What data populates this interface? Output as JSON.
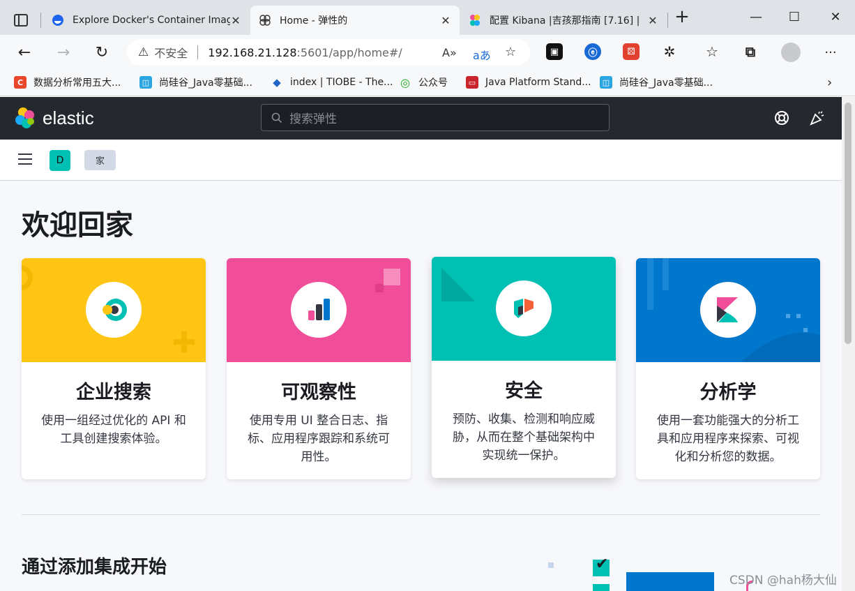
{
  "tabs": [
    {
      "title": "Explore Docker's Container Imag",
      "close": "✕"
    },
    {
      "title": "Home - 弹性的",
      "close": "✕"
    },
    {
      "title": "配置 Kibana |吉孩那指南 [7.16] |",
      "close": "✕"
    }
  ],
  "new_tab": "+",
  "window": {
    "minimize": "—",
    "maximize": "☐",
    "close": "✕"
  },
  "address_bar": {
    "security_label": "不安全",
    "host": "192.168.21.128",
    "path": ":5601/app/home#/"
  },
  "bookmarks": [
    {
      "label": "数据分析常用五大...",
      "icon": "C",
      "color": "#e8472b"
    },
    {
      "label": "尚硅谷_Java零基础...",
      "icon": "◫",
      "color": "#2ca6e0"
    },
    {
      "label": "index | TIOBE - The...",
      "icon": "◆",
      "color": "#1f63c6"
    },
    {
      "label": "公众号",
      "icon": "◎",
      "color": "#1aad19"
    },
    {
      "label": "Java Platform Stand...",
      "icon": "▭",
      "color": "#c9252c"
    },
    {
      "label": "尚硅谷_Java零基础...",
      "icon": "◫",
      "color": "#2ca6e0"
    }
  ],
  "kibana": {
    "brand": "elastic",
    "search_placeholder": "搜索弹性",
    "space_initial": "D",
    "breadcrumb": "家"
  },
  "page": {
    "title": "欢迎回家",
    "cards": [
      {
        "title": "企业搜索",
        "description": "使用一组经过优化的 API 和工具创建搜索体验。",
        "color": "#fec514",
        "icon": "enterprise-search-icon"
      },
      {
        "title": "可观察性",
        "description": "使用专用 UI 整合日志、指标、应用程序跟踪和系统可用性。",
        "color": "#f04e98",
        "icon": "observability-icon"
      },
      {
        "title": "安全",
        "description": "预防、收集、检测和响应威胁，从而在整个基础架构中实现统一保护。",
        "color": "#00bfb3",
        "icon": "security-icon"
      },
      {
        "title": "分析学",
        "description": "使用一套功能强大的分析工具和应用程序来探索、可视化和分析您的数据。",
        "color": "#0077cc",
        "icon": "analytics-icon"
      }
    ],
    "section_title": "通过添加集成开始",
    "watermark": "CSDN @hah杨大仙"
  }
}
